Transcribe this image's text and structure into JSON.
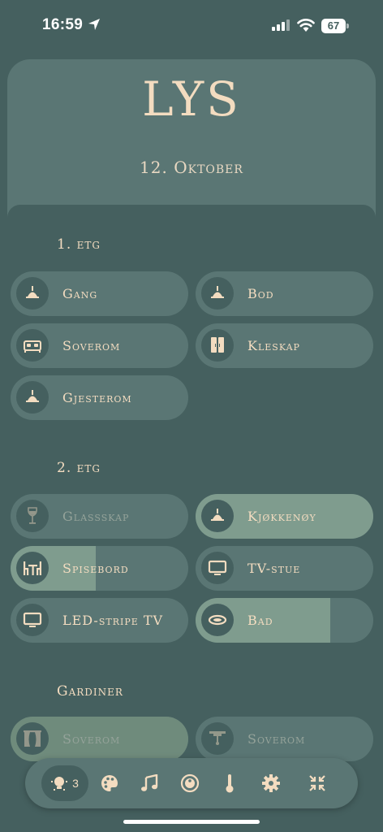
{
  "status": {
    "time": "16:59",
    "battery": "67"
  },
  "header": {
    "title": "LYS",
    "date": "12. Oktober"
  },
  "sections": [
    {
      "title": "1. etg"
    },
    {
      "title": "2. etg"
    },
    {
      "title": "Gardiner"
    }
  ],
  "tiles": {
    "gang": {
      "label": "Gang",
      "icon": "ceiling-lamp-icon",
      "state": "on",
      "level": 0
    },
    "bod": {
      "label": "Bod",
      "icon": "ceiling-lamp-icon",
      "state": "on",
      "level": 0
    },
    "soverom": {
      "label": "Soverom",
      "icon": "bed-icon",
      "state": "on",
      "level": 0
    },
    "kleskap": {
      "label": "Kleskap",
      "icon": "wardrobe-icon",
      "state": "on",
      "level": 0
    },
    "gjesterom": {
      "label": "Gjesterom",
      "icon": "ceiling-lamp-icon",
      "state": "on",
      "level": 0
    },
    "glassskap": {
      "label": "Glassskap",
      "icon": "wine-glass-icon",
      "state": "off",
      "level": 0
    },
    "kjokkenoy": {
      "label": "Kjøkkenøy",
      "icon": "ceiling-lamp-icon",
      "state": "on",
      "level": 1.0
    },
    "spisebord": {
      "label": "Spisebord",
      "icon": "dining-table-icon",
      "state": "on",
      "level": 0.48
    },
    "tvstue": {
      "label": "TV-stue",
      "icon": "tv-icon",
      "state": "on",
      "level": 0
    },
    "ledstripe": {
      "label": "LED-stripe TV",
      "icon": "tv-icon",
      "state": "on",
      "level": 0
    },
    "bad": {
      "label": "Bad",
      "icon": "ceiling-ring-icon",
      "state": "on",
      "level": 0.76
    },
    "gardin_soverom1": {
      "label": "Soverom",
      "icon": "curtains-icon",
      "state": "off",
      "level": 1.0
    },
    "gardin_soverom2": {
      "label": "Soverom",
      "icon": "blind-icon",
      "state": "off",
      "level": 0
    }
  },
  "nav": {
    "lights_count": "3",
    "items": [
      "lights-icon",
      "palette-icon",
      "music-icon",
      "robot-vacuum-icon",
      "thermometer-icon",
      "settings-icon",
      "collapse-icon"
    ]
  },
  "colors": {
    "background": "#45605f",
    "card": "#5a7674",
    "active_fill": "#7f9c8e",
    "text": "#f3dcc0"
  }
}
